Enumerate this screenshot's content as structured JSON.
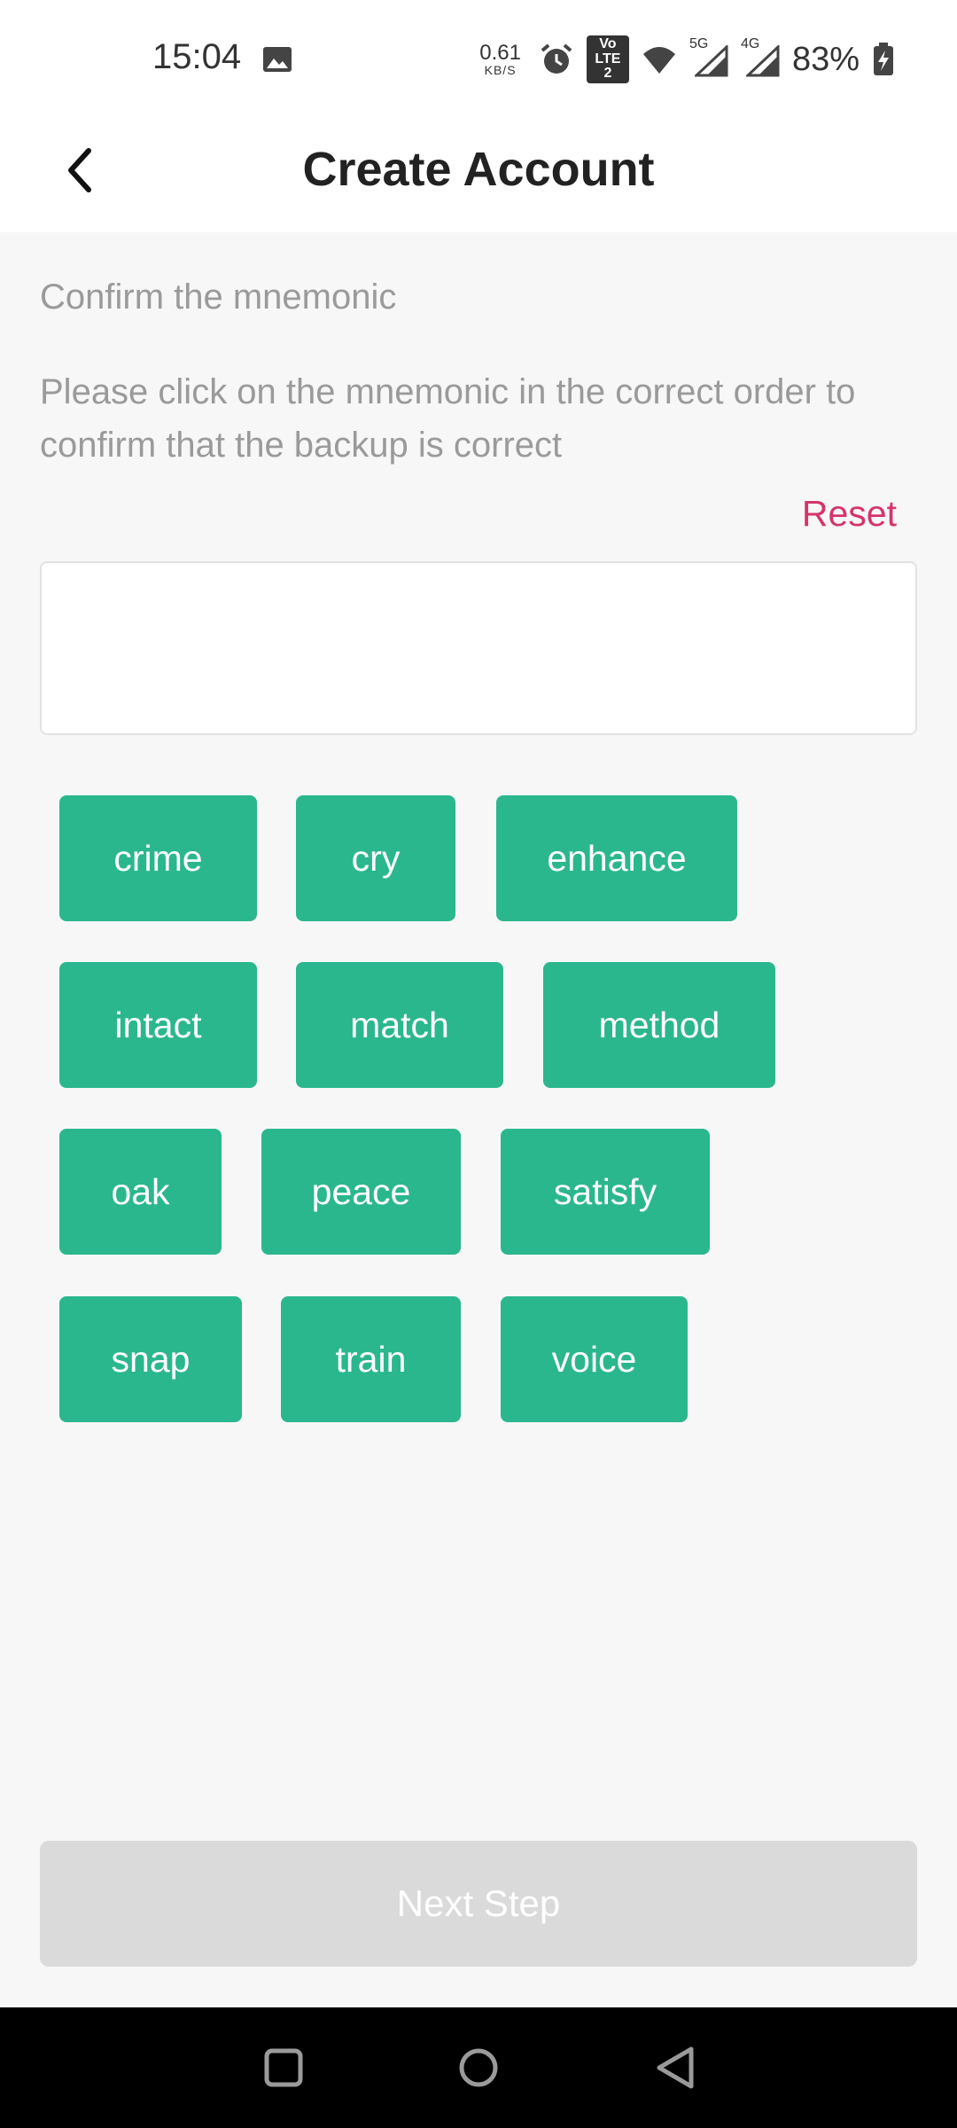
{
  "status_bar": {
    "time": "15:04",
    "net_speed_value": "0.61",
    "net_speed_unit": "KB/S",
    "volte_line1": "Vo",
    "volte_line2": "LTE 2",
    "sig1_label": "5G",
    "sig2_label": "4G",
    "battery": "83%",
    "icons": [
      "gallery-icon",
      "alarm-icon",
      "volte-icon",
      "wifi-icon",
      "signal-5g-icon",
      "signal-4g-icon",
      "battery-charging-icon"
    ]
  },
  "header": {
    "back_icon": "chevron-left-icon",
    "title": "Create Account"
  },
  "content": {
    "section_title": "Confirm the mnemonic",
    "instructions": "Please click on the mnemonic in the correct order to confirm that the backup is correct",
    "reset_label": "Reset",
    "selected_words": [],
    "words": [
      "crime",
      "cry",
      "enhance",
      "intact",
      "match",
      "method",
      "oak",
      "peace",
      "satisfy",
      "snap",
      "train",
      "voice"
    ]
  },
  "footer": {
    "next_label": "Next Step",
    "next_enabled": false
  },
  "nav_bar": {
    "icons": [
      "recents-icon",
      "home-icon",
      "back-icon"
    ]
  },
  "colors": {
    "accent": "#2bb78e",
    "reset": "#d6336c",
    "disabled": "#dadada",
    "background": "#f7f7f7"
  }
}
